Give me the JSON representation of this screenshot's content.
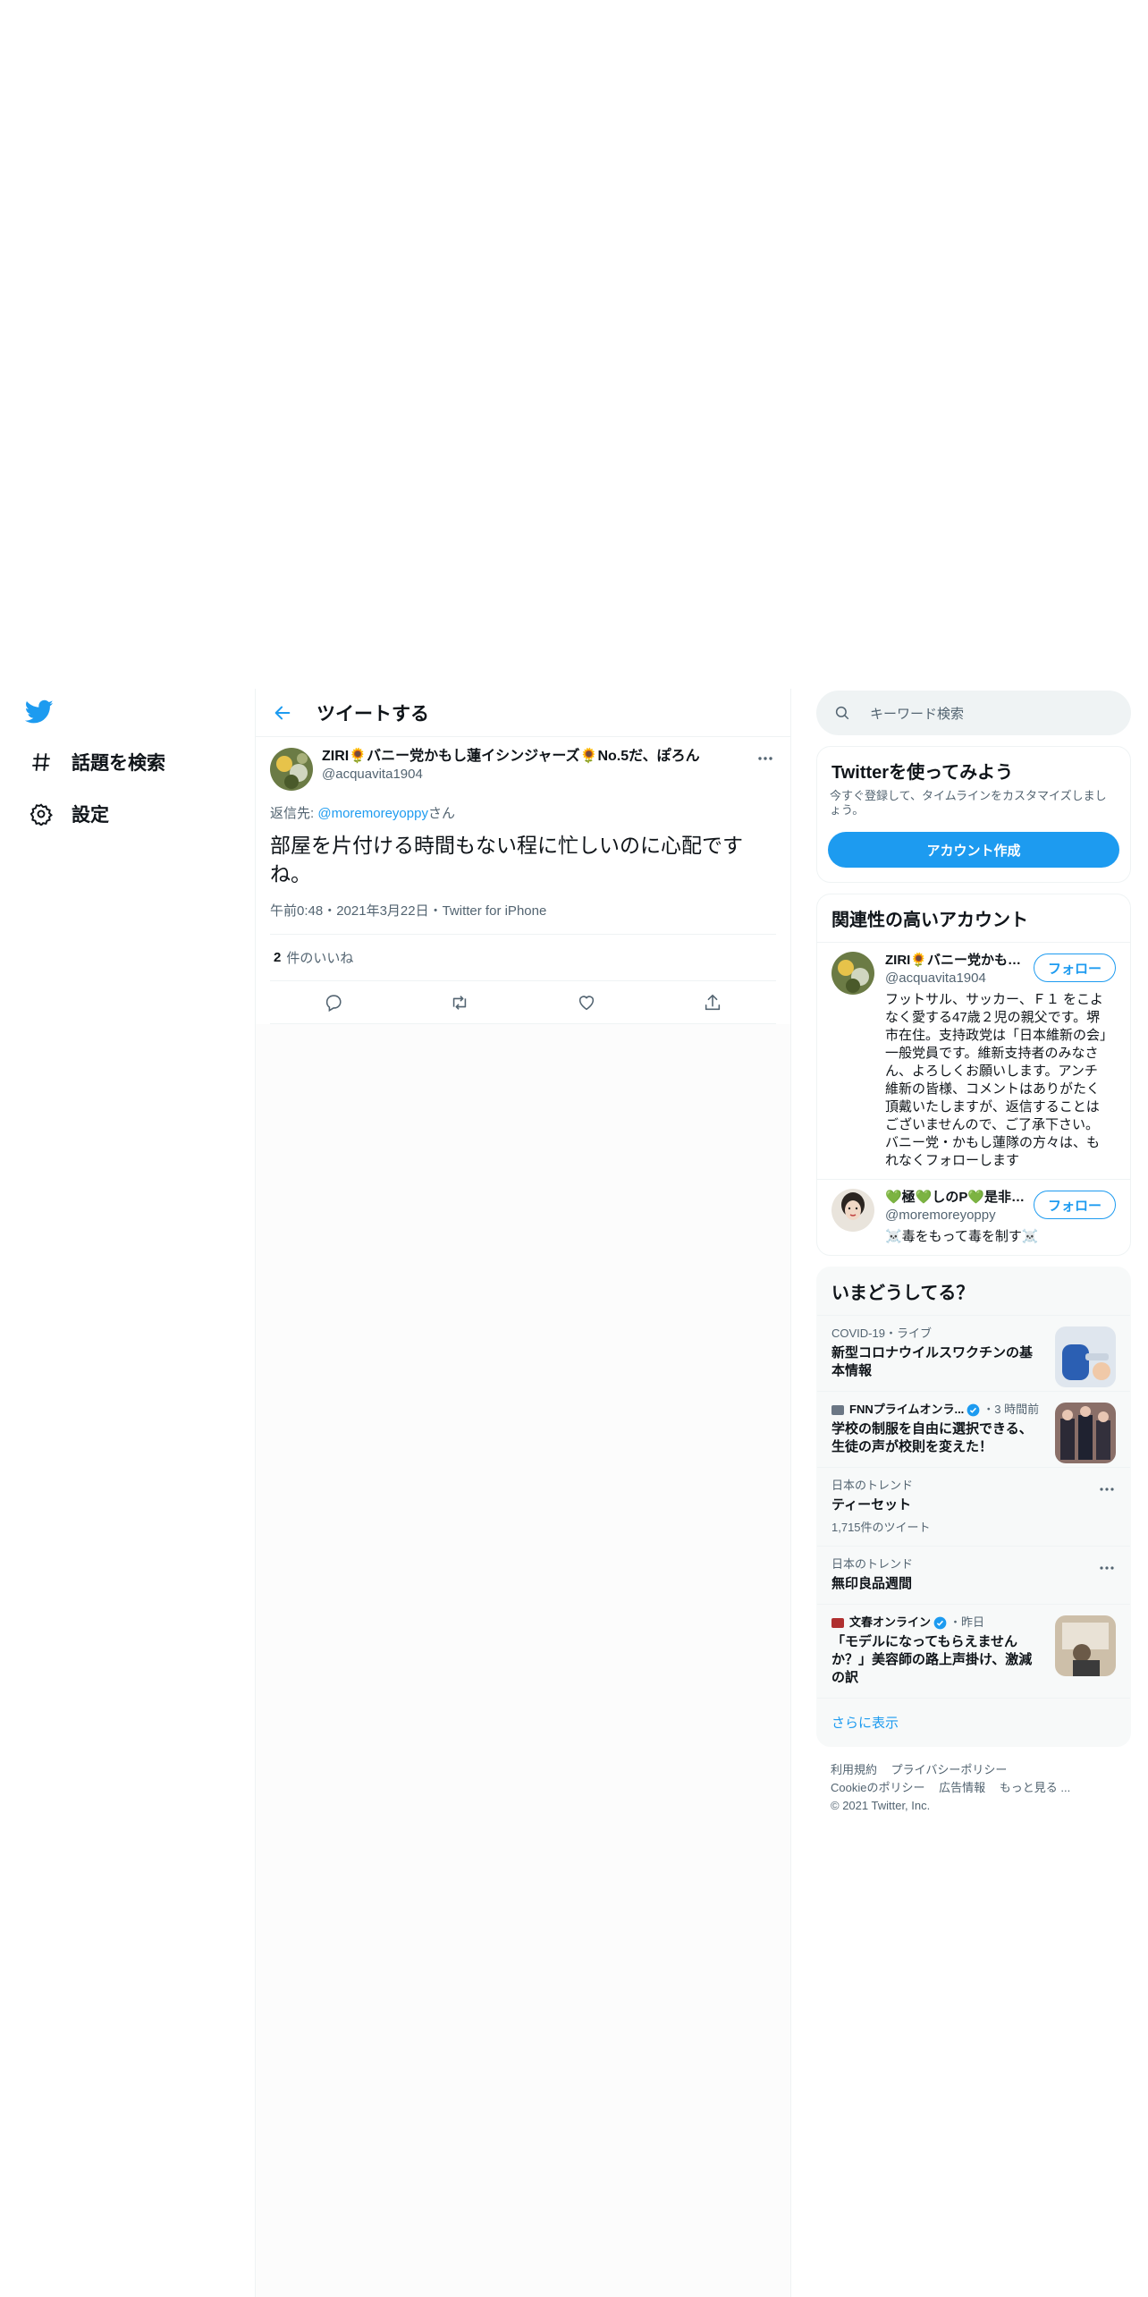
{
  "nav": {
    "items": [
      {
        "label": "話題を検索",
        "icon": "hashtag-icon"
      },
      {
        "label": "設定",
        "icon": "gear-icon"
      }
    ]
  },
  "header": {
    "title": "ツイートする"
  },
  "tweet": {
    "author_name": "ZIRI🌻バニー党かもし蓮イシンジャーズ🌻No.5だ、ぽろん",
    "author_handle": "@acquavita1904",
    "reply_prefix": "返信先: ",
    "reply_mention": "@moremoreyoppy",
    "reply_suffix": "さん",
    "text": "部屋を片付ける時間もない程に忙しいのに心配ですね。",
    "meta": "午前0:48・2021年3月22日・Twitter for iPhone",
    "likes_count": "2",
    "likes_label": "件のいいね"
  },
  "search": {
    "placeholder": "キーワード検索"
  },
  "signup": {
    "title": "Twitterを使ってみよう",
    "subtitle": "今すぐ登録して、タイムラインをカスタマイズしましょう。",
    "button": "アカウント作成"
  },
  "related": {
    "title": "関連性の高いアカウント",
    "accounts": [
      {
        "name": "ZIRI🌻バニー党かもし蓮イシンジャーズ",
        "handle": "@acquavita1904",
        "bio": "フットサル、サッカー、Ｆ１ をこよなく愛する47歳２児の親父です。堺市在住。支持政党は「日本維新の会」一般党員です。維新支持者のみなさん、よろしくお願いします。アンチ維新の皆様、コメントはありがたく頂戴いたしますが、返信することはございませんので、ご了承下さい。 バニー党・かもし蓮隊の方々は、もれなくフォローします",
        "follow": "フォロー"
      },
      {
        "name": "💚極💚しのP💚是非…",
        "handle": "@moremoreyoppy",
        "bio": "☠️毒をもって毒を制す☠️",
        "follow": "フォロー"
      }
    ]
  },
  "trends": {
    "title": "いまどうしてる？",
    "items": [
      {
        "context": "COVID-19・ライブ",
        "title": "新型コロナウイルスワクチンの基本情報",
        "count": "",
        "kind": "thumb"
      },
      {
        "context": "FNNプライムオンラ...",
        "context_time": "・3 時間前",
        "title": "学校の制服を自由に選択できる、生徒の声が校則を変えた！",
        "count": "",
        "kind": "thumb"
      },
      {
        "context": "日本のトレンド",
        "title": "ティーセット",
        "count": "1,715件のツイート",
        "kind": "dots"
      },
      {
        "context": "日本のトレンド",
        "title": "無印良品週間",
        "count": "",
        "kind": "dots"
      },
      {
        "context": "文春オンライン",
        "context_time": "・昨日",
        "title": "「モデルになってもらえませんか？」美容師の路上声掛け、激減の訳",
        "count": "",
        "kind": "thumb"
      }
    ],
    "show_more": "さらに表示"
  },
  "footer": {
    "links": [
      "利用規約",
      "プライバシーポリシー",
      "Cookieのポリシー",
      "広告情報",
      "もっと見る ..."
    ],
    "copyright": "© 2021 Twitter, Inc."
  },
  "colors": {
    "accent": "#1d9bf0",
    "text": "#0f1419",
    "muted": "#536471",
    "border": "#eff3f4"
  }
}
